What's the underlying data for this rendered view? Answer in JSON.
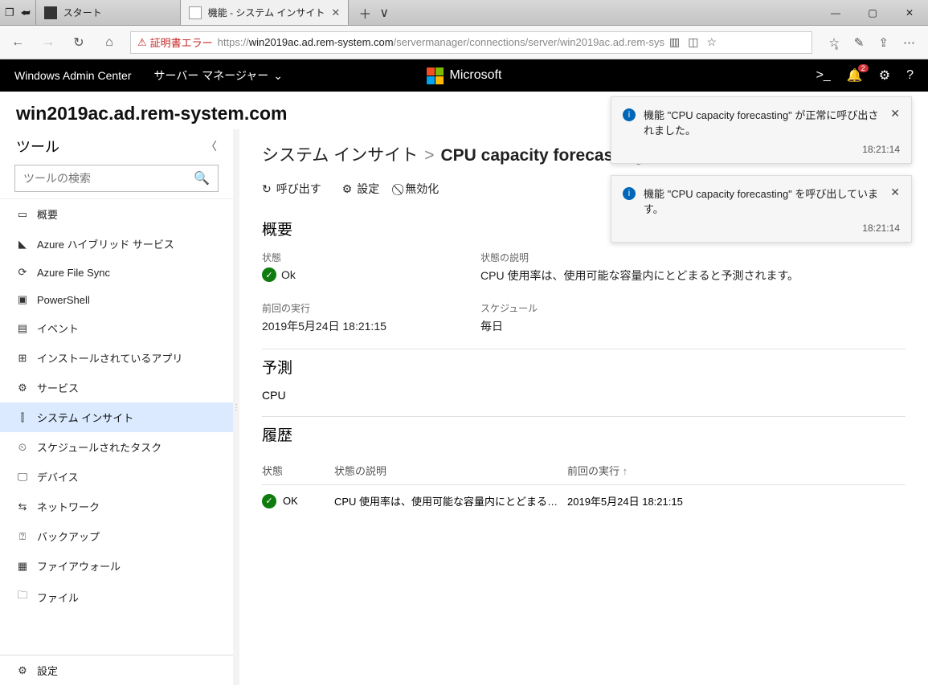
{
  "titlebar": {
    "tab1": "スタート",
    "tab2": "機能 - システム インサイト"
  },
  "navbar": {
    "cert_error": "証明書エラー",
    "url_scheme": "https://",
    "url_host": "win2019ac.ad.rem-system.com",
    "url_path": "/servermanager/connections/server/win2019ac.ad.rem-sys"
  },
  "wac": {
    "brand": "Windows Admin Center",
    "crumb": "サーバー マネージャー",
    "ms": "Microsoft",
    "badge": "2"
  },
  "server": "win2019ac.ad.rem-system.com",
  "sidebar": {
    "title": "ツール",
    "search_placeholder": "ツールの検索",
    "items": [
      {
        "icon": "▭",
        "label": "概要"
      },
      {
        "icon": "◣",
        "label": "Azure ハイブリッド サービス"
      },
      {
        "icon": "⟳",
        "label": "Azure File Sync"
      },
      {
        "icon": "▣",
        "label": "PowerShell"
      },
      {
        "icon": "▤",
        "label": "イベント"
      },
      {
        "icon": "⊞",
        "label": "インストールされているアプリ"
      },
      {
        "icon": "⚙",
        "label": "サービス"
      },
      {
        "icon": "⫿",
        "label": "システム インサイト"
      },
      {
        "icon": "⏲",
        "label": "スケジュールされたタスク"
      },
      {
        "icon": "🖵",
        "label": "デバイス"
      },
      {
        "icon": "⇆",
        "label": "ネットワーク"
      },
      {
        "icon": "⍰",
        "label": "バックアップ"
      },
      {
        "icon": "▦",
        "label": "ファイアウォール"
      },
      {
        "icon": "🗀",
        "label": "ファイル"
      }
    ],
    "footer": {
      "icon": "⚙",
      "label": "設定"
    }
  },
  "breadcrumb": {
    "root": "システム インサイト",
    "sep": ">",
    "current": "CPU capacity forecasting"
  },
  "toolbar": {
    "invoke": "呼び出す",
    "settings": "設定",
    "disable": "無効化"
  },
  "overview": {
    "heading": "概要",
    "state_label": "状態",
    "state_value": "Ok",
    "desc_label": "状態の説明",
    "desc_value": "CPU 使用率は、使用可能な容量内にとどまると予測されます。",
    "last_label": "前回の実行",
    "last_value": "2019年5月24日 18:21:15",
    "sched_label": "スケジュール",
    "sched_value": "毎日"
  },
  "predict": {
    "heading": "予測",
    "body": "CPU"
  },
  "history": {
    "heading": "履歴",
    "col_state": "状態",
    "col_desc": "状態の説明",
    "col_last": "前回の実行",
    "rows": [
      {
        "state": "OK",
        "desc": "CPU 使用率は、使用可能な容量内にとどまると予...",
        "last": "2019年5月24日 18:21:15"
      }
    ]
  },
  "toasts": [
    {
      "msg": "機能 \"CPU capacity forecasting\" が正常に呼び出されました。",
      "time": "18:21:14"
    },
    {
      "msg": "機能 \"CPU capacity forecasting\" を呼び出しています。",
      "time": "18:21:14"
    }
  ]
}
